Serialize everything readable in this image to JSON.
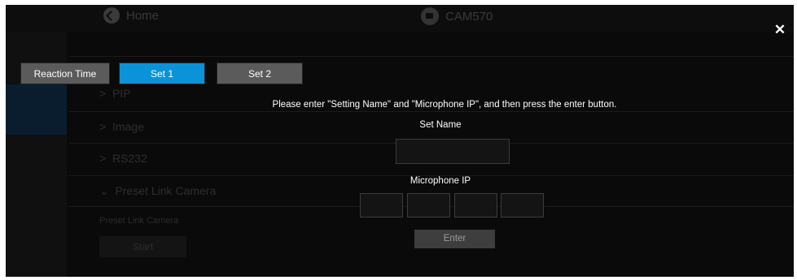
{
  "background": {
    "home_label": "Home",
    "camera_label": "CAM570",
    "menu": [
      {
        "label": "PIP"
      },
      {
        "label": "Image"
      },
      {
        "label": "RS232"
      },
      {
        "label": "Preset Link Camera",
        "expanded": true
      }
    ],
    "sub_label": "Preset Link Camera",
    "start_label": "Start"
  },
  "dialog": {
    "tabs": [
      {
        "label": "Reaction Time",
        "active": false
      },
      {
        "label": "Set 1",
        "active": true
      },
      {
        "label": "Set 2",
        "active": false
      }
    ],
    "close_glyph": "✕",
    "instruction": "Please enter \"Setting Name\" and \"Microphone IP\", and then press the enter button.",
    "set_name_label": "Set Name",
    "set_name_value": "",
    "mic_ip_label": "Microphone IP",
    "mic_ip_octets": [
      "",
      "",
      "",
      ""
    ],
    "enter_label": "Enter"
  },
  "colors": {
    "accent": "#0b93d9",
    "tab_inactive": "#5b5b5b",
    "overlay_bg": "#0a0a0a"
  }
}
